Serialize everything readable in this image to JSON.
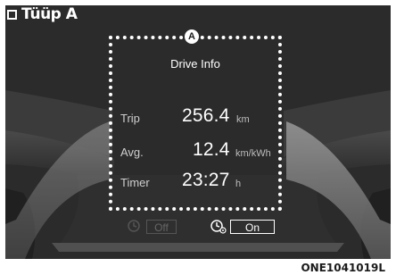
{
  "type_label": "Tüüp A",
  "marker_label": "A",
  "panel": {
    "title": "Drive Info",
    "rows": [
      {
        "label": "Trip",
        "value": "256.4",
        "unit": "km"
      },
      {
        "label": "Avg.",
        "value": "12.4",
        "unit": "km/kWh"
      },
      {
        "label": "Timer",
        "value": "23:27",
        "unit": "h"
      }
    ]
  },
  "bottom": {
    "off_label": "Off",
    "on_label": "On"
  },
  "figure_code": "ONE1041019L",
  "icons": {
    "off_icon": "clock-icon",
    "on_icon": "clock-gear-icon"
  }
}
